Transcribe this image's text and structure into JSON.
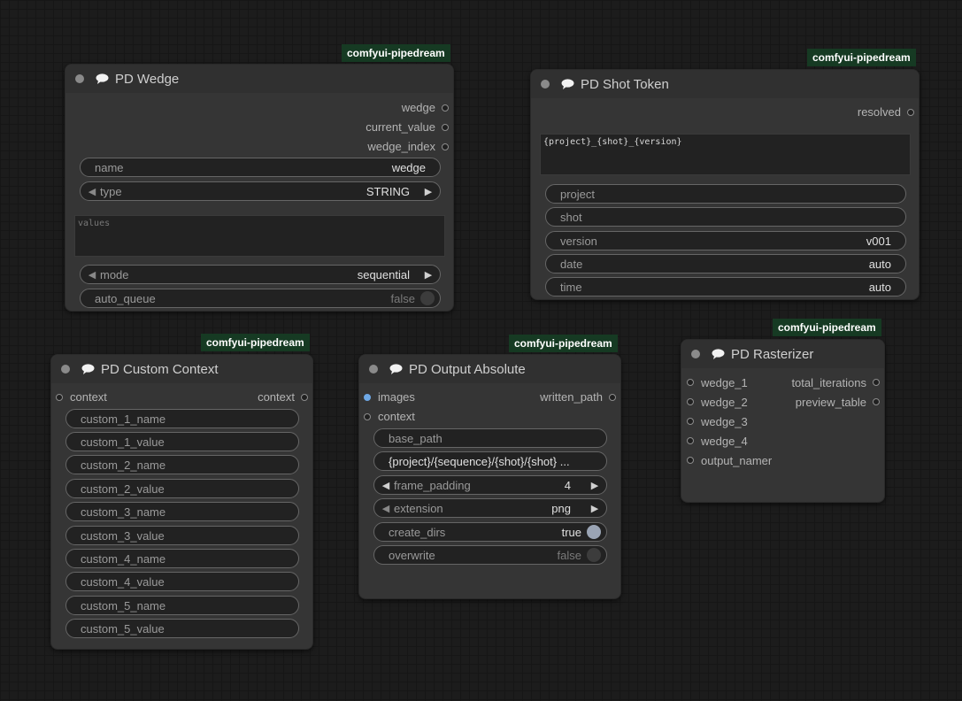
{
  "badge_text": "comfyui-pipedream",
  "nodes": {
    "wedge": {
      "title": "PD Wedge",
      "outputs": [
        "wedge",
        "current_value",
        "wedge_index"
      ],
      "name_label": "name",
      "name_value": "wedge",
      "type_label": "type",
      "type_value": "STRING",
      "values_placeholder": "values",
      "mode_label": "mode",
      "mode_value": "sequential",
      "auto_queue_label": "auto_queue",
      "auto_queue_value": "false"
    },
    "shot_token": {
      "title": "PD Shot Token",
      "output": "resolved",
      "template": "{project}_{shot}_{version}",
      "fields": [
        {
          "label": "project",
          "value": ""
        },
        {
          "label": "shot",
          "value": ""
        },
        {
          "label": "version",
          "value": "v001"
        },
        {
          "label": "date",
          "value": "auto"
        },
        {
          "label": "time",
          "value": "auto"
        }
      ]
    },
    "custom_context": {
      "title": "PD Custom Context",
      "input": "context",
      "output": "context",
      "fields": [
        "custom_1_name",
        "custom_1_value",
        "custom_2_name",
        "custom_2_value",
        "custom_3_name",
        "custom_3_value",
        "custom_4_name",
        "custom_4_value",
        "custom_5_name",
        "custom_5_value"
      ]
    },
    "output_absolute": {
      "title": "PD Output Absolute",
      "inputs": [
        "images",
        "context"
      ],
      "output": "written_path",
      "base_path_label": "base_path",
      "path_template": "{project}/{sequence}/{shot}/{shot} ...",
      "frame_padding_label": "frame_padding",
      "frame_padding_value": "4",
      "extension_label": "extension",
      "extension_value": "png",
      "create_dirs_label": "create_dirs",
      "create_dirs_value": "true",
      "overwrite_label": "overwrite",
      "overwrite_value": "false"
    },
    "rasterizer": {
      "title": "PD Rasterizer",
      "inputs": [
        "wedge_1",
        "wedge_2",
        "wedge_3",
        "wedge_4",
        "output_namer"
      ],
      "outputs": [
        "total_iterations",
        "preview_table"
      ]
    }
  },
  "colors": {
    "badge_bg": "#163a23",
    "node_bg": "#353535",
    "canvas_bg": "#1c1c1c",
    "connected_slot": "#6ea8e6"
  },
  "icons": [
    "collapse-dot-icon",
    "speech-bubble-icon",
    "arrow-left-icon",
    "arrow-right-icon",
    "toggle-knob-icon"
  ]
}
